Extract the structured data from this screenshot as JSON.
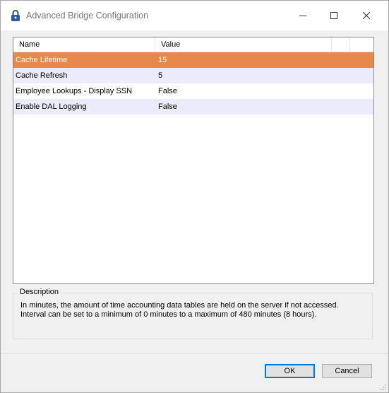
{
  "window": {
    "title": "Advanced Bridge Configuration"
  },
  "grid": {
    "columns": [
      "Name",
      "Value"
    ],
    "rows": [
      {
        "name": "Cache Lifetime",
        "value": "15",
        "selected": true
      },
      {
        "name": "Cache Refresh",
        "value": "5",
        "selected": false
      },
      {
        "name": "Employee Lookups - Display SSN",
        "value": "False",
        "selected": false
      },
      {
        "name": "Enable DAL Logging",
        "value": "False",
        "selected": false
      }
    ]
  },
  "description": {
    "legend": "Description",
    "line1": "In minutes, the amount of time accounting data tables are held on the server if not accessed.",
    "line2": "Interval can be set to a minimum of 0 minutes to a maximum of 480 minutes (8 hours)."
  },
  "buttons": {
    "ok": "OK",
    "cancel": "Cancel"
  },
  "colors": {
    "selected_row": "#e7894a",
    "alt_row": "#ebebfa",
    "default_button_border": "#0078d7"
  }
}
